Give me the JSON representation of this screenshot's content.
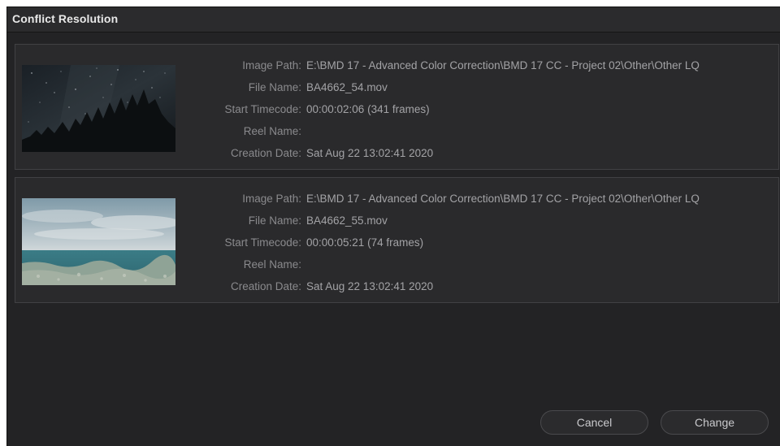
{
  "dialog": {
    "title": "Conflict Resolution"
  },
  "labels": {
    "image_path": "Image Path:",
    "file_name": "File Name:",
    "start_timecode": "Start Timecode:",
    "reel_name": "Reel Name:",
    "creation_date": "Creation Date:"
  },
  "clips": [
    {
      "image_path": "E:\\BMD 17 - Advanced Color Correction\\BMD 17 CC - Project 02\\Other\\Other LQ",
      "file_name": "BA4662_54.mov",
      "start_timecode": "00:00:02:06 (341 frames)",
      "reel_name": "",
      "creation_date": "Sat Aug 22 13:02:41 2020",
      "thumbnail": "night-sky-trees"
    },
    {
      "image_path": "E:\\BMD 17 - Advanced Color Correction\\BMD 17 CC - Project 02\\Other\\Other LQ",
      "file_name": "BA4662_55.mov",
      "start_timecode": "00:00:05:21 (74 frames)",
      "reel_name": "",
      "creation_date": "Sat Aug 22 13:02:41 2020",
      "thumbnail": "ocean-reef-sky"
    }
  ],
  "buttons": {
    "cancel": "Cancel",
    "change": "Change"
  }
}
